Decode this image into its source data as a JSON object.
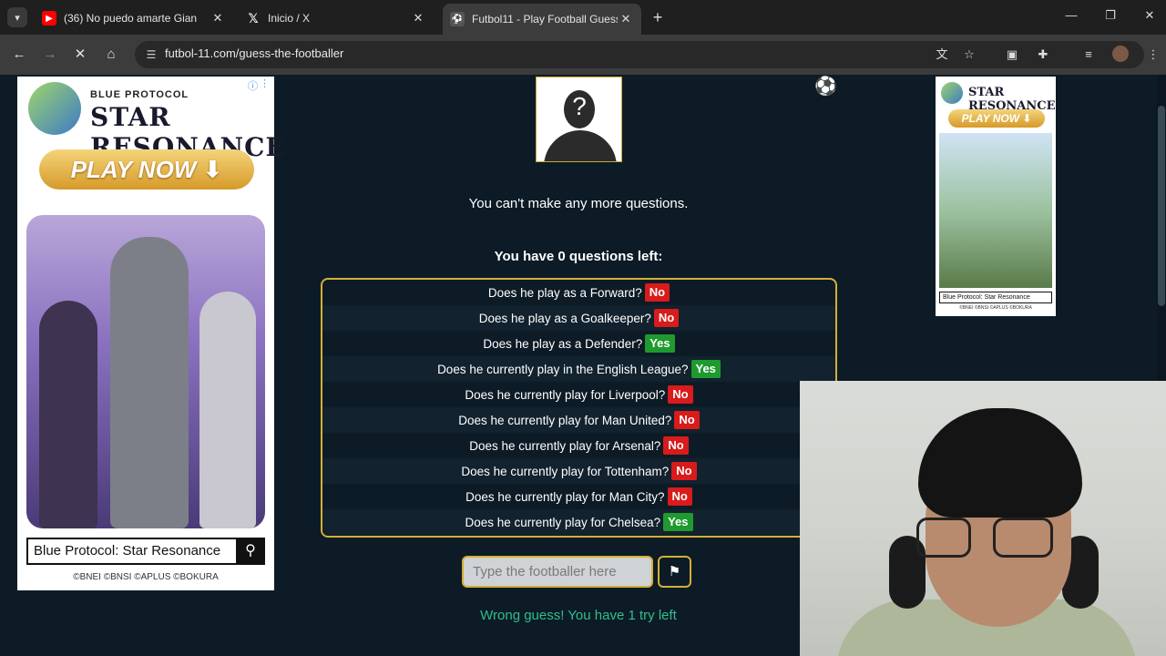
{
  "browser": {
    "tabs": [
      {
        "title": "(36) No puedo amarte Gian",
        "favicon": "youtube-icon",
        "color": "#ff0000"
      },
      {
        "title": "Inicio / X",
        "favicon": "x-icon",
        "color": "#000000"
      },
      {
        "title": "Futbol11 - Play Football Guess",
        "favicon": "futbol11-icon",
        "color": "#555555"
      }
    ],
    "url": "futbol-11.com/guess-the-footballer"
  },
  "ads": {
    "left": {
      "brand_small": "BLUE PROTOCOL",
      "brand": "STAR RESONANCE",
      "cta": "PLAY NOW ⬇",
      "search_text": "Blue Protocol: Star Resonance",
      "copyright": "©BNEI ©BNSI ©APLUS ©BOKURA"
    },
    "right": {
      "brand": "STAR RESONANCE",
      "cta": "PLAY NOW ⬇",
      "search_text": "Blue Protocol: Star Resonance",
      "copyright": "©BNEI ©BNSI ©APLUS ©BOKURA"
    }
  },
  "game": {
    "mystery_symbol": "?",
    "no_more_questions": "You can't make any more questions.",
    "questions_left": "You have 0 questions left:",
    "questions": [
      {
        "q": "Does he play as a Forward?",
        "a": "No"
      },
      {
        "q": "Does he play as a Goalkeeper?",
        "a": "No"
      },
      {
        "q": "Does he play as a Defender?",
        "a": "Yes"
      },
      {
        "q": "Does he currently play in the English League?",
        "a": "Yes"
      },
      {
        "q": "Does he currently play for Liverpool?",
        "a": "No"
      },
      {
        "q": "Does he currently play for Man United?",
        "a": "No"
      },
      {
        "q": "Does he currently play for Arsenal?",
        "a": "No"
      },
      {
        "q": "Does he currently play for Tottenham?",
        "a": "No"
      },
      {
        "q": "Does he currently play for Man City?",
        "a": "No"
      },
      {
        "q": "Does he currently play for Chelsea?",
        "a": "Yes"
      }
    ],
    "input_placeholder": "Type the footballer here",
    "feedback": "Wrong guess! You have 1 try left"
  },
  "colors": {
    "background": "#0d1b26",
    "accent_gold": "#d4af37",
    "answer_no": "#d81b1b",
    "answer_yes": "#1f9a2e",
    "feedback": "#2fbf8f"
  }
}
